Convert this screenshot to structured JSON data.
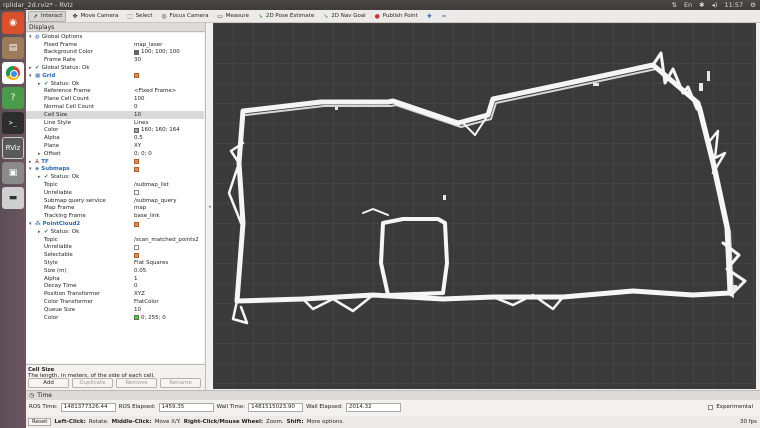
{
  "window": {
    "title": "rplidar_2d.rviz* - RViz",
    "clock": "11:57"
  },
  "launcher": [
    "ubuntu",
    "files",
    "chrome",
    "help",
    "terminal",
    "rviz",
    "files2",
    "disk"
  ],
  "toolbar": {
    "tools": [
      {
        "label": "Interact",
        "icon": "pointer-icon"
      },
      {
        "label": "Move Camera",
        "icon": "move-icon"
      },
      {
        "label": "Select",
        "icon": "select-icon"
      },
      {
        "label": "Focus Camera",
        "icon": "focus-icon"
      },
      {
        "label": "Measure",
        "icon": "ruler-icon"
      },
      {
        "label": "2D Pose Estimate",
        "icon": "green-arrow-icon"
      },
      {
        "label": "2D Nav Goal",
        "icon": "green-arrow-icon"
      },
      {
        "label": "Publish Point",
        "icon": "pin-icon"
      }
    ]
  },
  "displays": {
    "title": "Displays",
    "rows": [
      {
        "indent": 0,
        "arrow": "▾",
        "icon": "globe",
        "key": "Global Options",
        "value": "",
        "cat": false
      },
      {
        "indent": 1,
        "key": "Fixed Frame",
        "value": "map_laser"
      },
      {
        "indent": 1,
        "key": "Background Color",
        "value": "100; 100; 100",
        "swatch": "#646464"
      },
      {
        "indent": 1,
        "key": "Frame Rate",
        "value": "30"
      },
      {
        "indent": 0,
        "arrow": "▸",
        "icon": "tick",
        "key": "Global Status: Ok",
        "value": ""
      },
      {
        "indent": 0,
        "arrow": "▾",
        "icon": "grid",
        "key": "Grid",
        "value": "",
        "cat": true,
        "check": true
      },
      {
        "indent": 1,
        "arrow": "▸",
        "icon": "tick",
        "key": "Status: Ok",
        "value": ""
      },
      {
        "indent": 1,
        "key": "Reference Frame",
        "value": "<Fixed Frame>"
      },
      {
        "indent": 1,
        "key": "Plane Cell Count",
        "value": "100"
      },
      {
        "indent": 1,
        "key": "Normal Cell Count",
        "value": "0"
      },
      {
        "indent": 1,
        "key": "Cell Size",
        "value": "10",
        "sel": true
      },
      {
        "indent": 1,
        "key": "Line Style",
        "value": "Lines"
      },
      {
        "indent": 1,
        "key": "Color",
        "value": "160; 160; 164",
        "swatch": "#a0a0a4"
      },
      {
        "indent": 1,
        "key": "Alpha",
        "value": "0.5"
      },
      {
        "indent": 1,
        "key": "Plane",
        "value": "XY"
      },
      {
        "indent": 1,
        "arrow": "▸",
        "key": "Offset",
        "value": "0; 0; 0"
      },
      {
        "indent": 0,
        "arrow": "▸",
        "icon": "tf",
        "key": "TF",
        "value": "",
        "cat": true,
        "check": true
      },
      {
        "indent": 0,
        "arrow": "▾",
        "icon": "submaps",
        "key": "Submaps",
        "value": "",
        "cat": true,
        "check": true
      },
      {
        "indent": 1,
        "arrow": "▸",
        "icon": "tick",
        "key": "Status: Ok",
        "value": ""
      },
      {
        "indent": 1,
        "key": "Topic",
        "value": "/submap_list"
      },
      {
        "indent": 1,
        "key": "Unreliable",
        "value": "",
        "check": false
      },
      {
        "indent": 1,
        "key": "Submap query service",
        "value": "/submap_query"
      },
      {
        "indent": 1,
        "key": "Map Frame",
        "value": "map"
      },
      {
        "indent": 1,
        "key": "Tracking Frame",
        "value": "base_link"
      },
      {
        "indent": 0,
        "arrow": "▾",
        "icon": "cloud",
        "key": "PointCloud2",
        "value": "",
        "cat": true,
        "check": true
      },
      {
        "indent": 1,
        "arrow": "▸",
        "icon": "tick",
        "key": "Status: Ok",
        "value": ""
      },
      {
        "indent": 1,
        "key": "Topic",
        "value": "/scan_matched_points2"
      },
      {
        "indent": 1,
        "key": "Unreliable",
        "value": "",
        "check": false
      },
      {
        "indent": 1,
        "key": "Selectable",
        "value": "",
        "check": true
      },
      {
        "indent": 1,
        "key": "Style",
        "value": "Flat Squares"
      },
      {
        "indent": 1,
        "key": "Size (m)",
        "value": "0.05"
      },
      {
        "indent": 1,
        "key": "Alpha",
        "value": "1"
      },
      {
        "indent": 1,
        "key": "Decay Time",
        "value": "0"
      },
      {
        "indent": 1,
        "key": "Position Transformer",
        "value": "XYZ"
      },
      {
        "indent": 1,
        "key": "Color Transformer",
        "value": "FlatColor"
      },
      {
        "indent": 1,
        "key": "Queue Size",
        "value": "10"
      },
      {
        "indent": 1,
        "key": "Color",
        "value": "0; 255; 0",
        "swatch": "#00ff00"
      }
    ],
    "description": {
      "title": "Cell Size",
      "text": "The length, in meters, of the side of each cell."
    },
    "buttons": [
      {
        "label": "Add",
        "enabled": true
      },
      {
        "label": "Duplicate",
        "enabled": false
      },
      {
        "label": "Remove",
        "enabled": false
      },
      {
        "label": "Rename",
        "enabled": false
      }
    ]
  },
  "time": {
    "title": "Time",
    "ros_time_label": "ROS Time:",
    "ros_time": "1481377326.44",
    "ros_elapsed_label": "ROS Elapsed:",
    "ros_elapsed": "1459.35",
    "wall_time_label": "Wall Time:",
    "wall_time": "1481515023.90",
    "wall_elapsed_label": "Wall Elapsed:",
    "wall_elapsed": "2014.32",
    "experimental_label": "Experimental"
  },
  "status": {
    "reset_label": "Reset",
    "hint_1": "Left-Click:",
    "hint_1_text": "Rotate.",
    "hint_2": "Middle-Click:",
    "hint_2_text": "Move X/Y.",
    "hint_3": "Right-Click/Mouse Wheel:",
    "hint_3_text": "Zoom.",
    "hint_4": "Shift:",
    "hint_4_text": "More options.",
    "fps": "30 fps"
  },
  "colors": {
    "viewport_bg": "#303030",
    "grid_line": "#5a5a5a",
    "map_white": "#f4f4f4"
  }
}
